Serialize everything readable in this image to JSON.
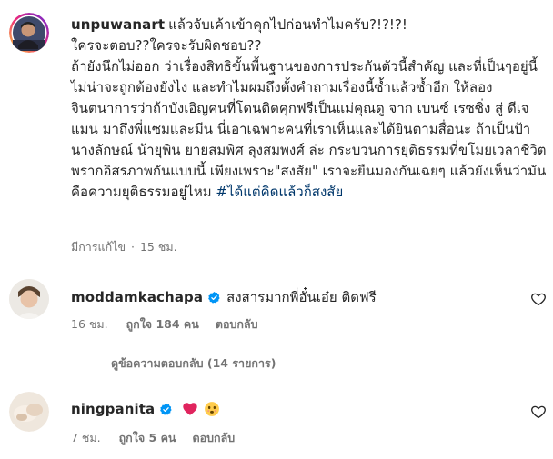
{
  "post": {
    "username": "unpuwanart",
    "caption_lines": [
      "แล้วจับเค้าเข้าคุกไปก่อนทำไมครับ?!?!?!",
      "ใครจะตอบ??ใครจะรับผิดชอบ??",
      "ถ้ายังนึกไม่ออก ว่าเรื่องสิทธิขั้นพื้นฐานของการประกันตัวนี้สำคัญ และที่เป็นๆอยู่นี้ไม่น่าจะถูกต้องยังไง และทำไมผมถึงตั้งคำถามเรื่องนี้ซ้ำแล้วซ้ำอีก ให้ลองจินตนาการว่าถ้าบังเอิญคนที่โดนติดคุกฟรีเป็นแม่คุณดู จาก เบนซ์ เรซซิ่ง สู่ ดีเจแมน มาถึงพี่แซมและมีน นี่เอาเฉพาะคนที่เราเห็นและได้ยินตามสื่อนะ ถ้าเป็นป้านางลักษณ์ น้ายุพิน ยายสมพิศ ลุงสมพงศ์ ล่ะ กระบวนการยุติธรรมที่ขโมยเวลาชีวิต พรากอิสรภาพกันแบบนี้ เพียงเพราะ\"สงสัย\" เราจะยืนมองกันเฉยๆ แล้วยังเห็นว่ามันคือความยุติธรรมอยู่ไหม"
    ],
    "hashtag": "#ได้แต่คิดแล้วก็สงสัย",
    "edited_label": "มีการแก้ไข",
    "time": "15 ชม."
  },
  "comments": [
    {
      "username": "moddamkachapa",
      "text": "สงสารมากพี่อั๋นเอ๋ย ติดฟรี",
      "time": "16 ชม.",
      "likes": "ถูกใจ 184 คน",
      "reply_label": "ตอบกลับ"
    },
    {
      "username": "ningpanita",
      "emojis": [
        "red-heart",
        "sad-face"
      ],
      "time": "7 ชม.",
      "likes": "ถูกใจ 5 คน",
      "reply_label": "ตอบกลับ"
    }
  ],
  "view_replies": "ดูข้อความตอบกลับ (14 รายการ)",
  "colors": {
    "verified": "#0095f6",
    "hashtag": "#00376b",
    "meta": "#737373",
    "text": "#262626"
  }
}
